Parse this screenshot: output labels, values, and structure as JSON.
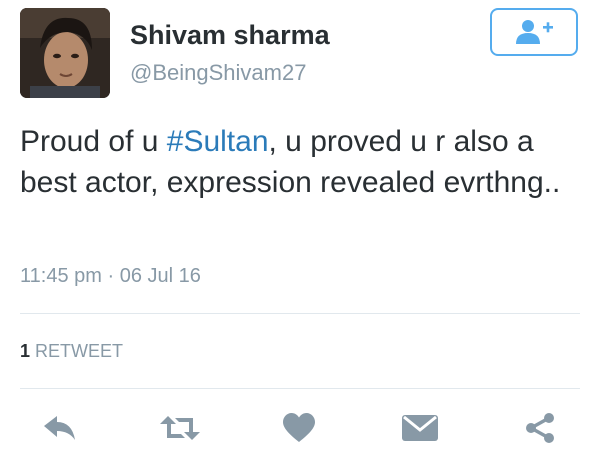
{
  "user": {
    "display_name": "Shivam sharma",
    "handle": "@BeingShivam27",
    "avatar_icon": "profile-photo"
  },
  "follow_button": {
    "icon": "follow-user-plus-icon",
    "color": "#55acee"
  },
  "tweet": {
    "text_before": "Proud of u ",
    "hashtag": "#Sultan",
    "text_after": ", u proved u r also a best actor, expression revealed evrthng..",
    "hashtag_color": "#2b7bb9"
  },
  "meta": {
    "time": "11:45 pm",
    "separator": "·",
    "date": "06 Jul 16"
  },
  "stats": {
    "retweet_count": "1",
    "retweet_label": "RETWEET"
  },
  "actions": [
    {
      "icon": "reply-icon"
    },
    {
      "icon": "retweet-icon"
    },
    {
      "icon": "like-heart-icon"
    },
    {
      "icon": "direct-message-icon"
    },
    {
      "icon": "share-icon"
    }
  ],
  "colors": {
    "text": "#292f33",
    "muted": "#8899a6",
    "accent": "#55acee",
    "divider": "#e1e8ed"
  }
}
